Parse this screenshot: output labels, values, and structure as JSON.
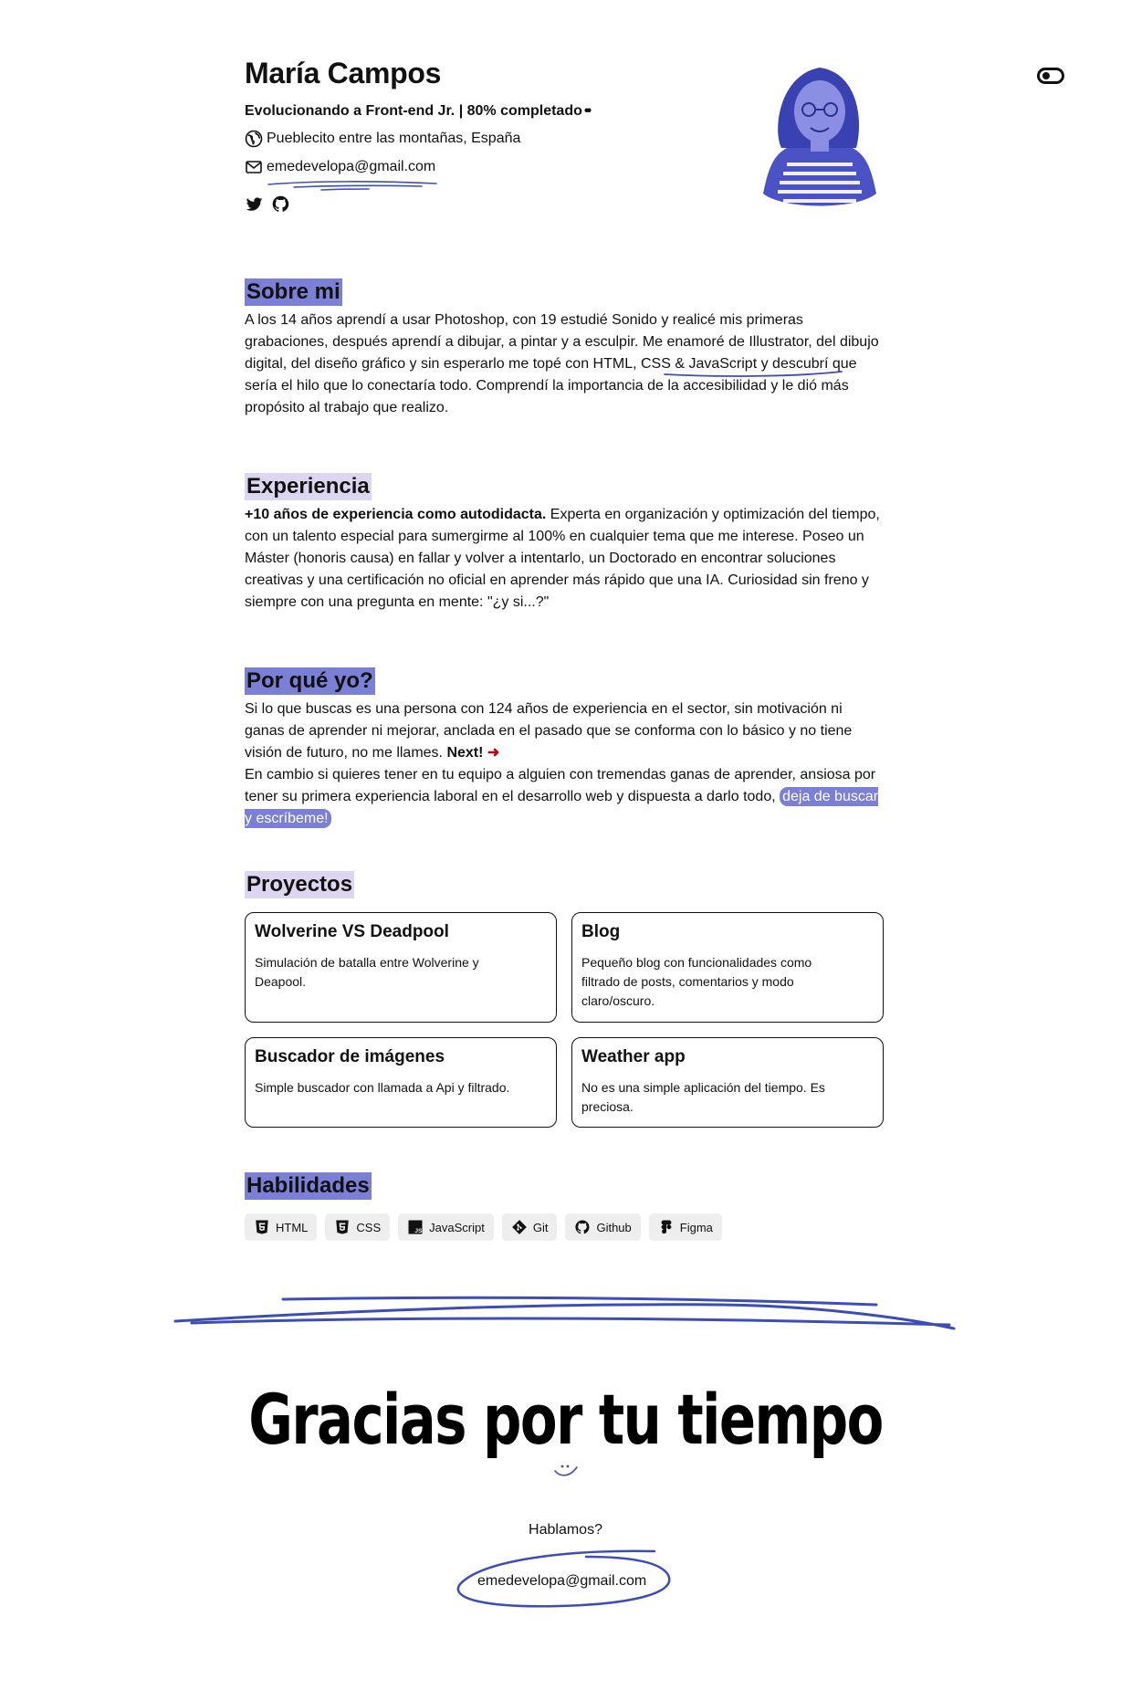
{
  "header": {
    "name": "María Campos",
    "tagline": "Evolucionando a Front-end Jr. | 80% completado",
    "progress_percent": 80,
    "location": "Pueblecito entre las montañas, España",
    "email": "emedevelopa@gmail.com",
    "icons": [
      "globe-icon",
      "mail-icon",
      "twitter-icon",
      "github-icon",
      "theme-toggle-icon"
    ]
  },
  "about": {
    "title": "Sobre mi",
    "text_1": "A los 14 años aprendí a usar Photoshop, con 19 estudié Sonido y realicé mis primeras grabaciones, después aprendí a dibujar, a pintar y a esculpir. Me enamoré de Illustrator, del dibujo digital, del diseño gráfico y sin esperarlo me topé con ",
    "link": "HTML, CSS & JavaScript",
    "text_2": " y descubrí que sería el hilo que lo conectaría todo. Comprendí la importancia de la accesibilidad y le dió más propósito al trabajo que realizo."
  },
  "experience": {
    "title": "Experiencia",
    "bold": "+10 años de experiencia como autodidacta.",
    "text": " Experta en organización y optimización del tiempo, con un talento especial para sumergirme al 100% en cualquier tema que me interese. Poseo un Máster (honoris causa) en fallar y volver a intentarlo, un Doctorado en encontrar soluciones creativas y una certificación no oficial en aprender más rápido que una IA. Curiosidad sin freno y siempre con una pregunta en mente: \"¿y si...?\""
  },
  "why": {
    "title": "Por qué yo?",
    "text_1": "Si lo que buscas es una persona con 124 años de experiencia en el sector, sin motivación ni ganas de aprender ni mejorar, anclada en el pasado que se conforma con lo básico y no tiene visión de futuro, no me llames. ",
    "next": "Next!",
    "arrow": "➜",
    "text_2": "En cambio si quieres tener en tu equipo a alguien con tremendas ganas de aprender, ansiosa por tener su primera experiencia laboral en el desarrollo web y dispuesta a darlo todo, ",
    "cta": "deja de buscar y escríbeme!"
  },
  "projects": {
    "title": "Proyectos",
    "items": [
      {
        "name": "Wolverine VS Deadpool",
        "desc": "Simulación de batalla entre Wolverine y Deapool."
      },
      {
        "name": "Blog",
        "desc": "Pequeño blog con funcionalidades como filtrado de posts, comentarios y modo claro/oscuro."
      },
      {
        "name": "Buscador de imágenes",
        "desc": "Simple buscador con llamada a Api y filtrado."
      },
      {
        "name": "Weather app",
        "desc": "No es una simple aplicación del tiempo. Es preciosa."
      }
    ]
  },
  "skills": {
    "title": "Habilidades",
    "items": [
      {
        "label": "HTML",
        "icon": "html5-icon"
      },
      {
        "label": "CSS",
        "icon": "css3-icon"
      },
      {
        "label": "JavaScript",
        "icon": "javascript-icon"
      },
      {
        "label": "Git",
        "icon": "git-icon"
      },
      {
        "label": "Github",
        "icon": "github-icon"
      },
      {
        "label": "Figma",
        "icon": "figma-icon"
      }
    ]
  },
  "footer": {
    "thanks": "Gracias por tu tiempo",
    "talk": "Hablamos?",
    "email": "emedevelopa@gmail.com"
  },
  "colors": {
    "accent": "#7b7fd6",
    "accent_light": "#ddd6f0",
    "scribble": "#3d4db3",
    "arrow": "#c00018"
  }
}
